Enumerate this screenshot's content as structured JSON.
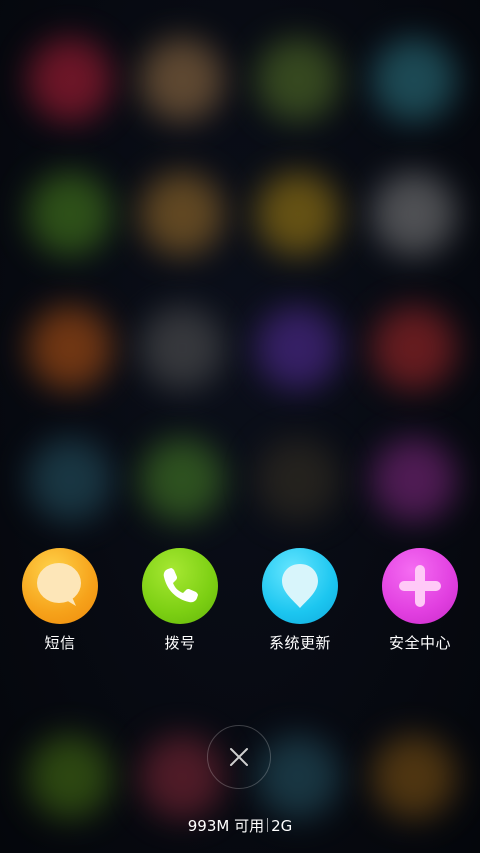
{
  "shortcuts": [
    {
      "label": "短信",
      "icon": "message-bubble-icon",
      "color": "#f39c12"
    },
    {
      "label": "拨号",
      "icon": "phone-icon",
      "color": "#7ccf13"
    },
    {
      "label": "系统更新",
      "icon": "balloon-update-icon",
      "color": "#1cc6f0"
    },
    {
      "label": "安全中心",
      "icon": "plus-shield-icon",
      "color": "#e13fe0"
    }
  ],
  "close": {
    "icon": "close-icon"
  },
  "memory": {
    "available": "993M 可用",
    "total": "2G"
  }
}
